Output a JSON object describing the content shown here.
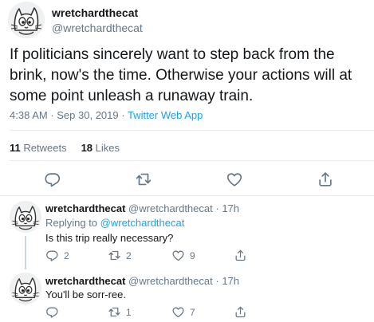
{
  "main_tweet": {
    "author_name": "wretchardthecat",
    "author_handle": "@wretchardthecat",
    "text": "If politicians sincerely want to step back from the brink, now's the time.  Otherwise your actions will at some point unleash a runaway train.",
    "time": "4:38 AM",
    "date": "Sep 30, 2019",
    "separator": " · ",
    "app": "Twitter Web App",
    "retweets_count": "11",
    "retweets_label": "Retweets",
    "likes_count": "18",
    "likes_label": "Likes"
  },
  "replies": [
    {
      "author_name": "wretchardthecat",
      "author_handle": "@wretchardthecat",
      "age": "17h",
      "replying_prefix": "Replying to ",
      "replying_to": "@wretchardthecat",
      "text": "Is this trip really necessary?",
      "reply_count": "2",
      "retweet_count": "2",
      "like_count": "9"
    },
    {
      "author_name": "wretchardthecat",
      "author_handle": "@wretchardthecat",
      "age": "17h",
      "text": "You'll be sorr-ree.",
      "reply_count": "",
      "retweet_count": "1",
      "like_count": "7"
    }
  ],
  "colors": {
    "link": "#1da1f2",
    "muted": "#657786",
    "text": "#14171a",
    "divider": "#e6ecf0"
  },
  "icons": [
    "cat-avatar-icon",
    "reply-icon",
    "retweet-icon",
    "like-icon",
    "share-icon"
  ]
}
